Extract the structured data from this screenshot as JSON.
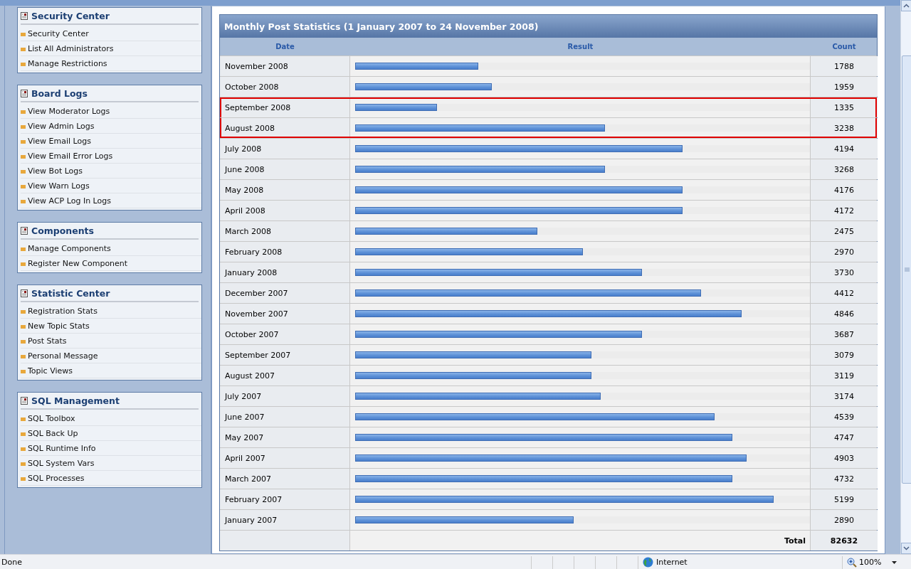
{
  "sidebar": [
    {
      "title": "Security Center",
      "items": [
        "Security Center",
        "List All Administrators",
        "Manage Restrictions"
      ]
    },
    {
      "title": "Board Logs",
      "items": [
        "View Moderator Logs",
        "View Admin Logs",
        "View Email Logs",
        "View Email Error Logs",
        "View Bot Logs",
        "View Warn Logs",
        "View ACP Log In Logs"
      ]
    },
    {
      "title": "Components",
      "items": [
        "Manage Components",
        "Register New Component"
      ]
    },
    {
      "title": "Statistic Center",
      "items": [
        "Registration Stats",
        "New Topic Stats",
        "Post Stats",
        "Personal Message",
        "Topic Views"
      ]
    },
    {
      "title": "SQL Management",
      "items": [
        "SQL Toolbox",
        "SQL Back Up",
        "SQL Runtime Info",
        "SQL System Vars",
        "SQL Processes"
      ]
    }
  ],
  "stats": {
    "title": "Monthly Post Statistics (1 January 2007 to 24 November 2008)",
    "columns": [
      "Date",
      "Result",
      "Count"
    ],
    "rows": [
      {
        "date": "November 2008",
        "level": 0.27,
        "count": "1788",
        "highlighted": false
      },
      {
        "date": "October 2008",
        "level": 0.3,
        "count": "1959",
        "highlighted": false
      },
      {
        "date": "September 2008",
        "level": 0.18,
        "count": "1335",
        "highlighted": true
      },
      {
        "date": "August 2008",
        "level": 0.55,
        "count": "3238",
        "highlighted": true
      },
      {
        "date": "July 2008",
        "level": 0.72,
        "count": "4194",
        "highlighted": false
      },
      {
        "date": "June 2008",
        "level": 0.55,
        "count": "3268",
        "highlighted": false
      },
      {
        "date": "May 2008",
        "level": 0.72,
        "count": "4176",
        "highlighted": false
      },
      {
        "date": "April 2008",
        "level": 0.72,
        "count": "4172",
        "highlighted": false
      },
      {
        "date": "March 2008",
        "level": 0.4,
        "count": "2475",
        "highlighted": false
      },
      {
        "date": "February 2008",
        "level": 0.5,
        "count": "2970",
        "highlighted": false
      },
      {
        "date": "January 2008",
        "level": 0.63,
        "count": "3730",
        "highlighted": false
      },
      {
        "date": "December 2007",
        "level": 0.76,
        "count": "4412",
        "highlighted": false
      },
      {
        "date": "November 2007",
        "level": 0.85,
        "count": "4846",
        "highlighted": false
      },
      {
        "date": "October 2007",
        "level": 0.63,
        "count": "3687",
        "highlighted": false
      },
      {
        "date": "September 2007",
        "level": 0.52,
        "count": "3079",
        "highlighted": false
      },
      {
        "date": "August 2007",
        "level": 0.52,
        "count": "3119",
        "highlighted": false
      },
      {
        "date": "July 2007",
        "level": 0.54,
        "count": "3174",
        "highlighted": false
      },
      {
        "date": "June 2007",
        "level": 0.79,
        "count": "4539",
        "highlighted": false
      },
      {
        "date": "May 2007",
        "level": 0.83,
        "count": "4747",
        "highlighted": false
      },
      {
        "date": "April 2007",
        "level": 0.86,
        "count": "4903",
        "highlighted": false
      },
      {
        "date": "March 2007",
        "level": 0.83,
        "count": "4732",
        "highlighted": false
      },
      {
        "date": "February 2007",
        "level": 0.92,
        "count": "5199",
        "highlighted": false
      },
      {
        "date": "January 2007",
        "level": 0.48,
        "count": "2890",
        "highlighted": false
      }
    ],
    "total_label": "Total",
    "total": "82632"
  },
  "status_bar": {
    "status": "Done",
    "zone": "Internet",
    "zoom": "100%"
  }
}
